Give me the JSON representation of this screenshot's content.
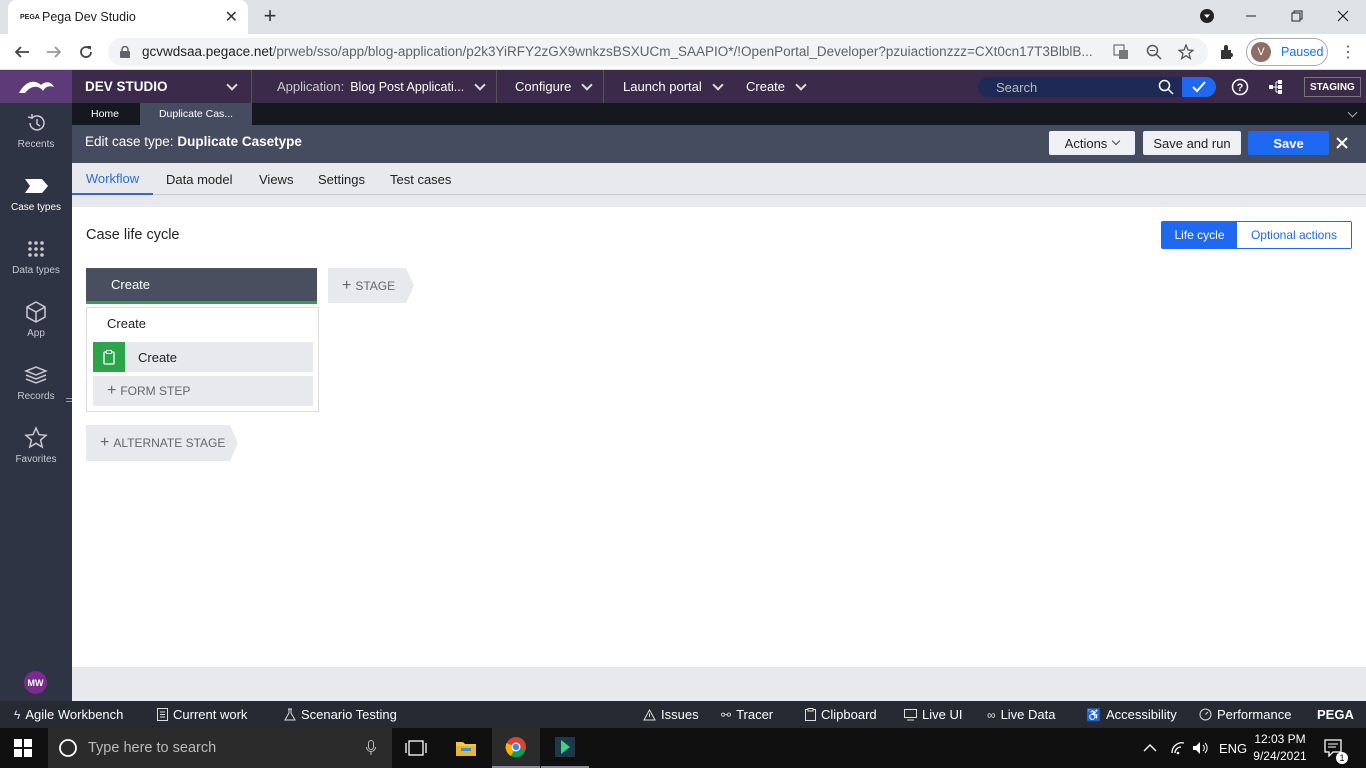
{
  "browser": {
    "tab_favicon": "PEGA",
    "tab_title": "Pega Dev Studio",
    "url_host": "gcvwdsaa.pegace.net",
    "url_path": "/prweb/sso/app/blog-application/p2k3YiRFY2zGX9wnkzsBSXUCm_SAAPIO*/!OpenPortal_Developer?pzuiactionzzz=CXt0cn17T3BlblB...",
    "profile_initial": "V",
    "profile_status": "Paused"
  },
  "header": {
    "studio": "DEV STUDIO",
    "application_label": "Application:",
    "application_value": "Blog Post Applicati...",
    "configure": "Configure",
    "launch_portal": "Launch portal",
    "create": "Create",
    "search_placeholder": "Search",
    "environment": "STAGING"
  },
  "leftnav": {
    "items": [
      {
        "label": "Recents",
        "icon": "history-icon"
      },
      {
        "label": "Case types",
        "icon": "case-type-icon"
      },
      {
        "label": "Data types",
        "icon": "data-types-icon"
      },
      {
        "label": "App",
        "icon": "cube-icon"
      },
      {
        "label": "Records",
        "icon": "layers-icon"
      },
      {
        "label": "Favorites",
        "icon": "star-icon"
      }
    ],
    "user_initials": "MW"
  },
  "doc_tabs": [
    "Home",
    "Duplicate Cas..."
  ],
  "edit": {
    "title_prefix": "Edit case type:",
    "title_name": "Duplicate Casetype",
    "actions": "Actions",
    "save_and_run": "Save and run",
    "save": "Save"
  },
  "subtabs": [
    "Workflow",
    "Data model",
    "Views",
    "Settings",
    "Test cases"
  ],
  "lifecycle": {
    "title": "Case life cycle",
    "toggle_active": "Life cycle",
    "toggle_inactive": "Optional actions",
    "stage_name": "Create",
    "add_stage": "STAGE",
    "process_name": "Create",
    "step_name": "Create",
    "add_form_step": "FORM STEP",
    "add_alternate_stage": "ALTERNATE STAGE"
  },
  "devbar": {
    "left": [
      "Agile Workbench",
      "Current work",
      "Scenario Testing"
    ],
    "right": [
      "Issues",
      "Tracer",
      "Clipboard",
      "Live UI",
      "Live Data",
      "Accessibility",
      "Performance"
    ],
    "brand": "PEGA"
  },
  "taskbar": {
    "search_placeholder": "Type here to search",
    "language": "ENG",
    "time": "12:03 PM",
    "date": "9/24/2021",
    "notifications": "1"
  }
}
